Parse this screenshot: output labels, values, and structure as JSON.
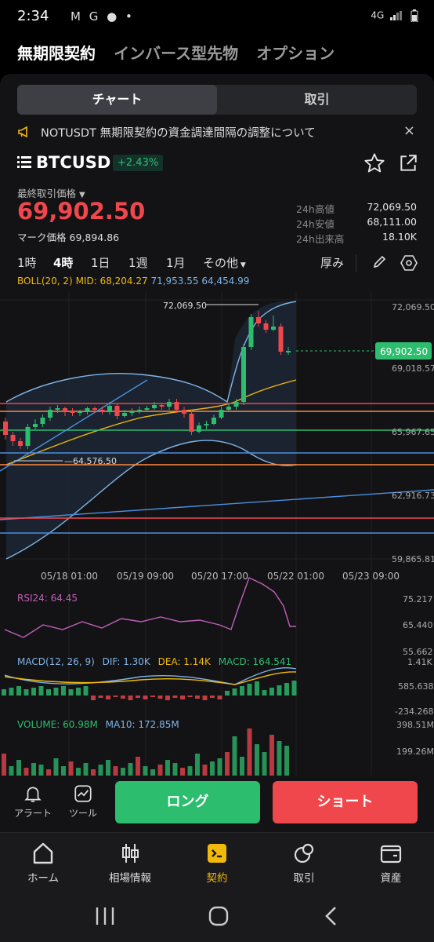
{
  "status_bar": {
    "time": "2:34",
    "icons_left": "M G ● •",
    "network": "4G"
  },
  "top_nav": {
    "tabs": [
      "無期限契約",
      "インバース型先物",
      "オプション"
    ]
  },
  "segment": {
    "chart": "チャート",
    "trade": "取引"
  },
  "notice": {
    "text": "NOTUSDT 無期限契約の資金調達間隔の調整について",
    "close": "×"
  },
  "pair": {
    "symbol": "BTCUSD",
    "change": "+2.43%"
  },
  "price": {
    "last_label": "最終取引価格",
    "last": "69,902.50",
    "mark_label": "マーク価格",
    "mark": "69,894.86"
  },
  "stats": [
    {
      "label": "24h高値",
      "value": "72,069.50"
    },
    {
      "label": "24h安値",
      "value": "68,111.00"
    },
    {
      "label": "24h出来高",
      "value": "18.10K"
    }
  ],
  "timeframes": {
    "items": [
      "1時",
      "4時",
      "1日",
      "1週",
      "1月",
      "その他"
    ],
    "active": "4時",
    "depth": "厚み"
  },
  "boll": {
    "label": "BOLL(20, 2)",
    "mid": "MID: 68,204.27",
    "up": "71,953.55",
    "low": "64,454.99"
  },
  "indicators": {
    "rsi": "RSI24: 64.45",
    "macd_label": "MACD(12, 26, 9)",
    "dif": "DIF: 1.30K",
    "dea": "DEA: 1.14K",
    "macd": "MACD: 164.541",
    "volume": "VOLUME: 60.98M",
    "ma10": "MA10: 172.85M"
  },
  "chart_data": {
    "type": "candlestick",
    "price_axis": [
      "72,069.50",
      "69,018.57",
      "65,967.65",
      "62,916.73",
      "59,865.81"
    ],
    "x_ticks": [
      "05/18 01:00",
      "05/19 09:00",
      "05/20 17:00",
      "05/22 01:00",
      "05/23 09:00"
    ],
    "current_price": "69,902.50",
    "annotations": {
      "high": "72,069.50",
      "low": "64,576.50"
    },
    "rsi_axis": [
      "75.217",
      "65.440",
      "55.662"
    ],
    "macd_axis": [
      "1.41K",
      "585.638",
      "-234.268"
    ],
    "volume_axis": [
      "398.51M",
      "199.26M"
    ],
    "colors": {
      "up": "#2dbd6e",
      "down": "#f0474d",
      "mid": "#f0b90b",
      "band": "#7fb4e6",
      "rsi": "#c25fb8"
    }
  },
  "actions": {
    "alert": "アラート",
    "tools": "ツール",
    "long": "ロング",
    "short": "ショート"
  },
  "tabs": [
    "ホーム",
    "相場情報",
    "契約",
    "取引",
    "資産"
  ]
}
